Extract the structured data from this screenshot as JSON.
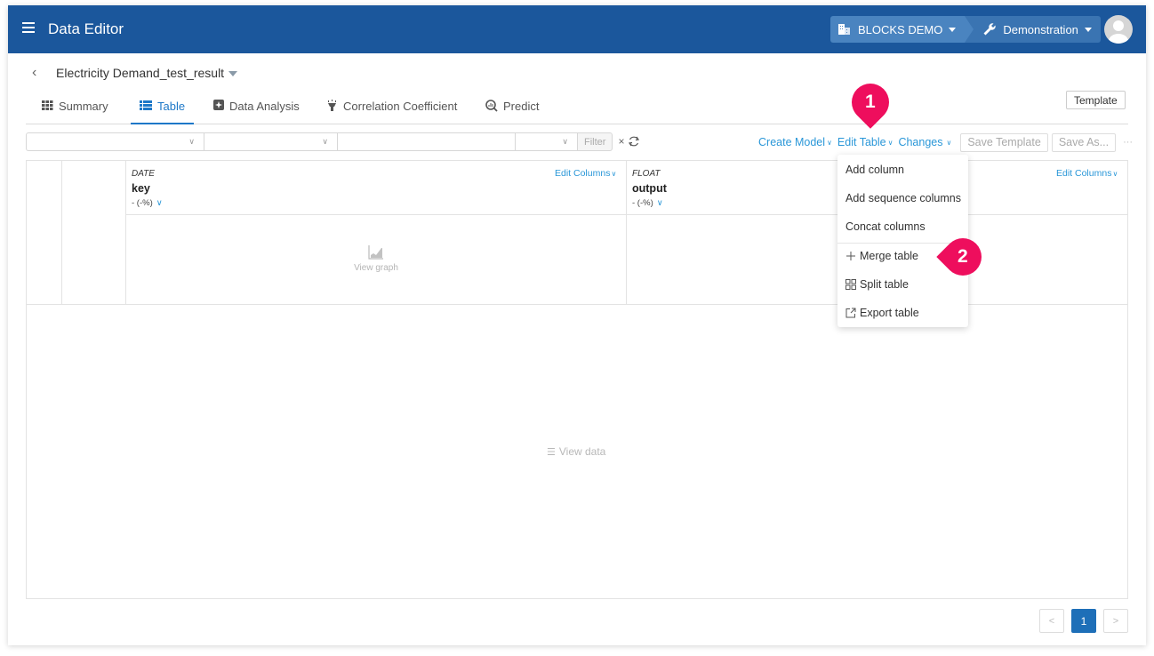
{
  "header": {
    "app_title": "Data Editor",
    "org_name": "BLOCKS DEMO",
    "project_name": "Demonstration"
  },
  "breadcrumb": {
    "dataset_title": "Electricity Demand_test_result"
  },
  "tabs": [
    {
      "label": "Summary",
      "icon": "grid-icon",
      "active": false
    },
    {
      "label": "Table",
      "icon": "table-icon",
      "active": true
    },
    {
      "label": "Data Analysis",
      "icon": "analysis-icon",
      "active": false
    },
    {
      "label": "Correlation Coefficient",
      "icon": "lamp-icon",
      "active": false
    },
    {
      "label": "Predict",
      "icon": "predict-search-icon",
      "active": false
    }
  ],
  "template_button": "Template",
  "filter_bar": {
    "column_select": "",
    "operator_select": "",
    "value_input": "",
    "type_select": "",
    "filter_button": "Filter",
    "clear_symbol": "×"
  },
  "actions": {
    "create_model": "Create Model",
    "edit_table": "Edit Table",
    "changes": "Changes",
    "save_template": "Save Template",
    "save_as": "Save As...",
    "more": "···"
  },
  "columns": [
    {
      "type": "DATE",
      "name": "key",
      "stat": "- (-%)",
      "edit_label": "Edit Columns",
      "placeholder": "View graph"
    },
    {
      "type": "FLOAT",
      "name": "output",
      "stat": "- (-%)",
      "edit_label": "Edit Columns"
    }
  ],
  "view_data": "View data",
  "edit_table_menu": {
    "items": [
      {
        "label": "Add column"
      },
      {
        "label": "Add sequence columns"
      },
      {
        "label": "Concat columns"
      },
      {
        "label": "Merge table",
        "icon": "plus-icon"
      },
      {
        "label": "Split table",
        "icon": "split-grid-icon"
      },
      {
        "label": "Export table",
        "icon": "export-icon"
      }
    ]
  },
  "callouts": {
    "step1": "1",
    "step2": "2",
    "color": "#ee0e5d"
  },
  "pagination": {
    "prev": "<",
    "current": "1",
    "next": ">"
  },
  "colors": {
    "header_bg": "#1b579c",
    "link": "#2a97d8",
    "active_tab": "#1e78c8"
  }
}
